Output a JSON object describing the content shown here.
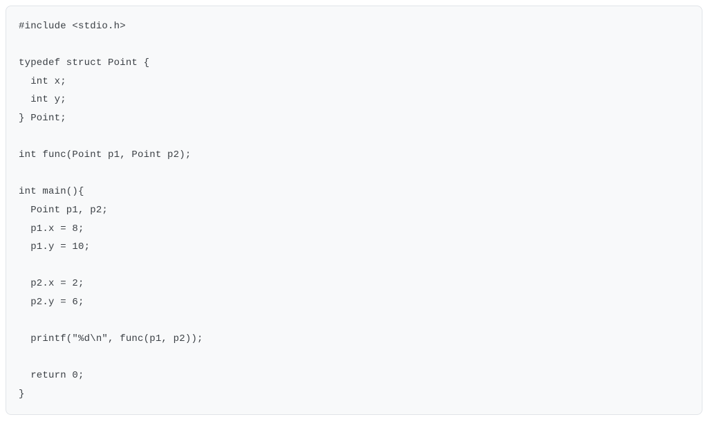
{
  "code": {
    "lines": [
      "#include <stdio.h>",
      "",
      "typedef struct Point {",
      "  int x;",
      "  int y;",
      "} Point;",
      "",
      "int func(Point p1, Point p2);",
      "",
      "int main(){",
      "  Point p1, p2;",
      "  p1.x = 8;",
      "  p1.y = 10;",
      "",
      "  p2.x = 2;",
      "  p2.y = 6;",
      "",
      "  printf(\"%d\\n\", func(p1, p2));",
      "",
      "  return 0;",
      "}"
    ]
  }
}
